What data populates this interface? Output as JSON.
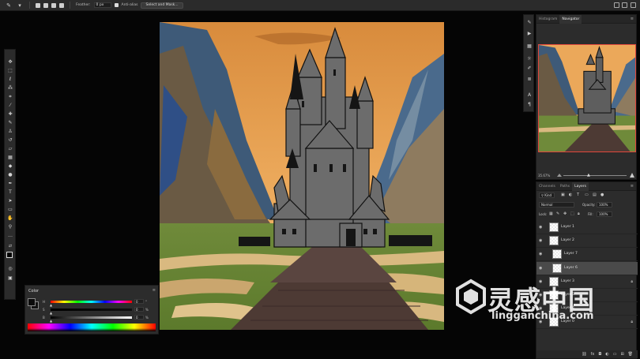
{
  "options_bar": {
    "feather_label": "Feather:",
    "feather_value": "0 px",
    "anti_alias_label": "Anti-alias",
    "select_mask_label": "Select and Mask..."
  },
  "toolbar": {
    "tools": [
      "move-icon",
      "marquee-icon",
      "lasso-icon",
      "magic-wand-icon",
      "crop-icon",
      "eyedropper-icon",
      "healing-icon",
      "brush-icon",
      "stamp-icon",
      "history-brush-icon",
      "eraser-icon",
      "gradient-icon",
      "blur-icon",
      "dodge-icon",
      "pen-icon",
      "type-icon",
      "path-select-icon",
      "rectangle-icon",
      "hand-icon",
      "zoom-icon",
      "more-icon"
    ]
  },
  "color_panel": {
    "title": "Color",
    "rows": [
      {
        "label": "H",
        "value": "0",
        "unit": "°",
        "position": 0.0
      },
      {
        "label": "S",
        "value": "0",
        "unit": "%",
        "position": 0.0
      },
      {
        "label": "B",
        "value": "0",
        "unit": "%",
        "position": 0.0
      }
    ]
  },
  "navigator_panel": {
    "tabs": [
      {
        "label": "Histogram",
        "active": false
      },
      {
        "label": "Navigator",
        "active": true
      }
    ],
    "zoom": "35.67%"
  },
  "layers_panel": {
    "tabs": [
      {
        "label": "Channels",
        "active": false
      },
      {
        "label": "Paths",
        "active": false
      },
      {
        "label": "Layers",
        "active": true
      }
    ],
    "filter_label": "Kind",
    "blend_mode": "Normal",
    "opacity_label": "Opacity:",
    "opacity_value": "100%",
    "lock_label": "Lock:",
    "fill_label": "Fill:",
    "fill_value": "100%",
    "layers": [
      {
        "name": "Layer 1",
        "selected": false,
        "indent": false,
        "lock": false
      },
      {
        "name": "Layer 2",
        "selected": false,
        "indent": false,
        "lock": false
      },
      {
        "name": "Layer 7",
        "selected": false,
        "indent": true,
        "lock": false
      },
      {
        "name": "Layer 6",
        "selected": true,
        "indent": true,
        "lock": false
      },
      {
        "name": "Layer 3",
        "selected": false,
        "indent": false,
        "lock": true
      },
      {
        "name": "Layer 5",
        "selected": false,
        "indent": false,
        "lock": false
      },
      {
        "name": "Layer 4",
        "selected": false,
        "indent": false,
        "lock": false
      },
      {
        "name": "Layer 0",
        "selected": false,
        "indent": false,
        "lock": true
      }
    ]
  },
  "watermark": {
    "text": "灵感中国",
    "url": "lingganchina.com"
  },
  "colors": {
    "accent_border": "#e0483d",
    "panel_bg": "#2c2c2c",
    "selected_layer": "#4a4a4a"
  }
}
